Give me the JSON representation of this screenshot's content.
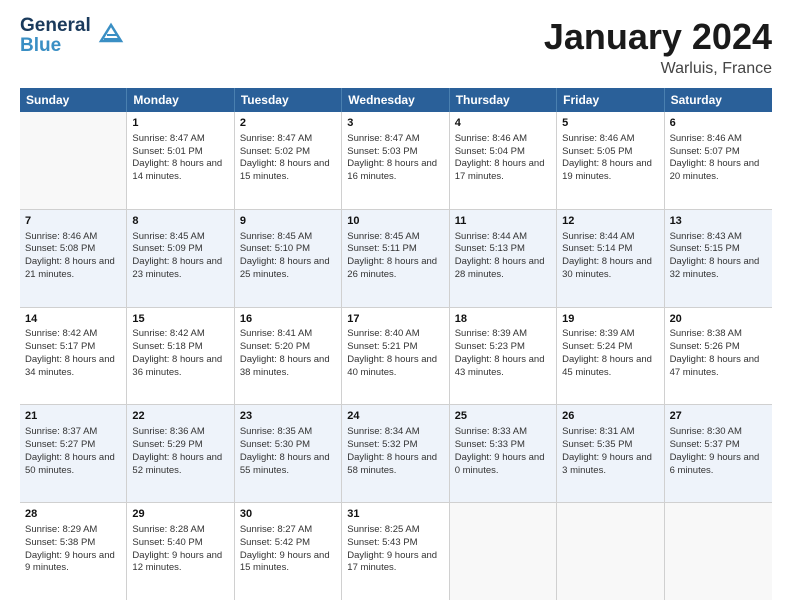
{
  "header": {
    "logo_line1": "General",
    "logo_line2": "Blue",
    "main_title": "January 2024",
    "subtitle": "Warluis, France"
  },
  "days_of_week": [
    "Sunday",
    "Monday",
    "Tuesday",
    "Wednesday",
    "Thursday",
    "Friday",
    "Saturday"
  ],
  "weeks": [
    [
      {
        "num": "",
        "sunrise": "",
        "sunset": "",
        "daylight": "",
        "empty": true
      },
      {
        "num": "1",
        "sunrise": "Sunrise: 8:47 AM",
        "sunset": "Sunset: 5:01 PM",
        "daylight": "Daylight: 8 hours and 14 minutes."
      },
      {
        "num": "2",
        "sunrise": "Sunrise: 8:47 AM",
        "sunset": "Sunset: 5:02 PM",
        "daylight": "Daylight: 8 hours and 15 minutes."
      },
      {
        "num": "3",
        "sunrise": "Sunrise: 8:47 AM",
        "sunset": "Sunset: 5:03 PM",
        "daylight": "Daylight: 8 hours and 16 minutes."
      },
      {
        "num": "4",
        "sunrise": "Sunrise: 8:46 AM",
        "sunset": "Sunset: 5:04 PM",
        "daylight": "Daylight: 8 hours and 17 minutes."
      },
      {
        "num": "5",
        "sunrise": "Sunrise: 8:46 AM",
        "sunset": "Sunset: 5:05 PM",
        "daylight": "Daylight: 8 hours and 19 minutes."
      },
      {
        "num": "6",
        "sunrise": "Sunrise: 8:46 AM",
        "sunset": "Sunset: 5:07 PM",
        "daylight": "Daylight: 8 hours and 20 minutes."
      }
    ],
    [
      {
        "num": "7",
        "sunrise": "",
        "sunset": "",
        "daylight": "Daylight: 8 hours and 21 minutes.",
        "sunrise_only": "Sunrise: 8:46 AM",
        "sunset_only": "Sunset: 5:08 PM"
      },
      {
        "num": "8",
        "sunrise": "Sunrise: 8:45 AM",
        "sunset": "Sunset: 5:09 PM",
        "daylight": "Daylight: 8 hours and 23 minutes."
      },
      {
        "num": "9",
        "sunrise": "Sunrise: 8:45 AM",
        "sunset": "Sunset: 5:10 PM",
        "daylight": "Daylight: 8 hours and 25 minutes."
      },
      {
        "num": "10",
        "sunrise": "Sunrise: 8:45 AM",
        "sunset": "Sunset: 5:11 PM",
        "daylight": "Daylight: 8 hours and 26 minutes."
      },
      {
        "num": "11",
        "sunrise": "Sunrise: 8:44 AM",
        "sunset": "Sunset: 5:13 PM",
        "daylight": "Daylight: 8 hours and 28 minutes."
      },
      {
        "num": "12",
        "sunrise": "Sunrise: 8:44 AM",
        "sunset": "Sunset: 5:14 PM",
        "daylight": "Daylight: 8 hours and 30 minutes."
      },
      {
        "num": "13",
        "sunrise": "Sunrise: 8:43 AM",
        "sunset": "Sunset: 5:15 PM",
        "daylight": "Daylight: 8 hours and 32 minutes."
      }
    ],
    [
      {
        "num": "14",
        "sunrise": "Sunrise: 8:42 AM",
        "sunset": "Sunset: 5:17 PM",
        "daylight": "Daylight: 8 hours and 34 minutes."
      },
      {
        "num": "15",
        "sunrise": "Sunrise: 8:42 AM",
        "sunset": "Sunset: 5:18 PM",
        "daylight": "Daylight: 8 hours and 36 minutes."
      },
      {
        "num": "16",
        "sunrise": "Sunrise: 8:41 AM",
        "sunset": "Sunset: 5:20 PM",
        "daylight": "Daylight: 8 hours and 38 minutes."
      },
      {
        "num": "17",
        "sunrise": "Sunrise: 8:40 AM",
        "sunset": "Sunset: 5:21 PM",
        "daylight": "Daylight: 8 hours and 40 minutes."
      },
      {
        "num": "18",
        "sunrise": "Sunrise: 8:39 AM",
        "sunset": "Sunset: 5:23 PM",
        "daylight": "Daylight: 8 hours and 43 minutes."
      },
      {
        "num": "19",
        "sunrise": "Sunrise: 8:39 AM",
        "sunset": "Sunset: 5:24 PM",
        "daylight": "Daylight: 8 hours and 45 minutes."
      },
      {
        "num": "20",
        "sunrise": "Sunrise: 8:38 AM",
        "sunset": "Sunset: 5:26 PM",
        "daylight": "Daylight: 8 hours and 47 minutes."
      }
    ],
    [
      {
        "num": "21",
        "sunrise": "Sunrise: 8:37 AM",
        "sunset": "Sunset: 5:27 PM",
        "daylight": "Daylight: 8 hours and 50 minutes."
      },
      {
        "num": "22",
        "sunrise": "Sunrise: 8:36 AM",
        "sunset": "Sunset: 5:29 PM",
        "daylight": "Daylight: 8 hours and 52 minutes."
      },
      {
        "num": "23",
        "sunrise": "Sunrise: 8:35 AM",
        "sunset": "Sunset: 5:30 PM",
        "daylight": "Daylight: 8 hours and 55 minutes."
      },
      {
        "num": "24",
        "sunrise": "Sunrise: 8:34 AM",
        "sunset": "Sunset: 5:32 PM",
        "daylight": "Daylight: 8 hours and 58 minutes."
      },
      {
        "num": "25",
        "sunrise": "Sunrise: 8:33 AM",
        "sunset": "Sunset: 5:33 PM",
        "daylight": "Daylight: 9 hours and 0 minutes."
      },
      {
        "num": "26",
        "sunrise": "Sunrise: 8:31 AM",
        "sunset": "Sunset: 5:35 PM",
        "daylight": "Daylight: 9 hours and 3 minutes."
      },
      {
        "num": "27",
        "sunrise": "Sunrise: 8:30 AM",
        "sunset": "Sunset: 5:37 PM",
        "daylight": "Daylight: 9 hours and 6 minutes."
      }
    ],
    [
      {
        "num": "28",
        "sunrise": "Sunrise: 8:29 AM",
        "sunset": "Sunset: 5:38 PM",
        "daylight": "Daylight: 9 hours and 9 minutes."
      },
      {
        "num": "29",
        "sunrise": "Sunrise: 8:28 AM",
        "sunset": "Sunset: 5:40 PM",
        "daylight": "Daylight: 9 hours and 12 minutes."
      },
      {
        "num": "30",
        "sunrise": "Sunrise: 8:27 AM",
        "sunset": "Sunset: 5:42 PM",
        "daylight": "Daylight: 9 hours and 15 minutes."
      },
      {
        "num": "31",
        "sunrise": "Sunrise: 8:25 AM",
        "sunset": "Sunset: 5:43 PM",
        "daylight": "Daylight: 9 hours and 17 minutes."
      },
      {
        "num": "",
        "sunrise": "",
        "sunset": "",
        "daylight": "",
        "empty": true
      },
      {
        "num": "",
        "sunrise": "",
        "sunset": "",
        "daylight": "",
        "empty": true
      },
      {
        "num": "",
        "sunrise": "",
        "sunset": "",
        "daylight": "",
        "empty": true
      }
    ]
  ]
}
